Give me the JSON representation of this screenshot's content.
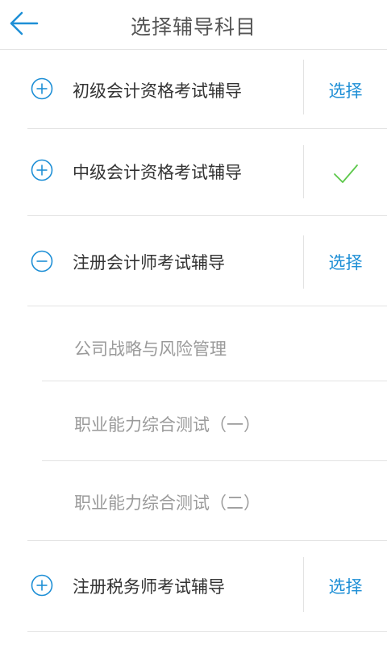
{
  "header": {
    "title": "选择辅导科目",
    "back_icon": "arrow-left-icon"
  },
  "colors": {
    "accent": "#1e8fd6",
    "check": "#5cc84a",
    "text": "#333333",
    "subtext": "#9a9a9a",
    "divider": "#e3e3e3"
  },
  "subjects": [
    {
      "label": "初级会计资格考试辅导",
      "expanded": false,
      "action": "选择",
      "selected": false
    },
    {
      "label": "中级会计资格考试辅导",
      "expanded": false,
      "action": "",
      "selected": true
    },
    {
      "label": "注册会计师考试辅导",
      "expanded": true,
      "action": "选择",
      "selected": false,
      "children": [
        {
          "label": "公司战略与风险管理"
        },
        {
          "label": "职业能力综合测试（一）"
        },
        {
          "label": "职业能力综合测试（二）"
        }
      ]
    },
    {
      "label": "注册税务师考试辅导",
      "expanded": false,
      "action": "选择",
      "selected": false
    }
  ]
}
